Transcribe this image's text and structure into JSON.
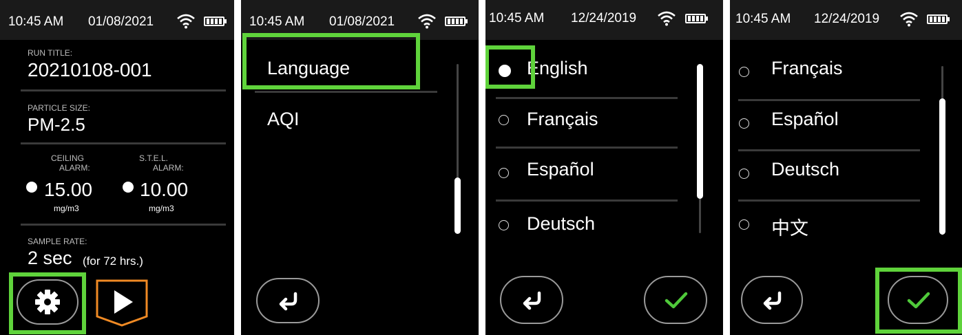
{
  "screen1": {
    "time": "10:45 AM",
    "date": "01/08/2021",
    "run_title_label": "RUN TITLE:",
    "run_title_value": "20210108-001",
    "particle_label": "PARTICLE SIZE:",
    "particle_value": "PM-2.5",
    "ceiling_label_1": "CEILING",
    "ceiling_label_2": "ALARM:",
    "ceiling_value": "15.00",
    "ceiling_unit": "mg/m3",
    "stel_label_1": "S.T.E.L.",
    "stel_label_2": "ALARM:",
    "stel_value": "10.00",
    "stel_unit": "mg/m3",
    "sample_label": "SAMPLE RATE:",
    "sample_value": "2 sec",
    "sample_note": "(for 72 hrs.)",
    "settings_icon": "gear-icon",
    "play_icon": "play-icon"
  },
  "screen2": {
    "time": "10:45 AM",
    "date": "01/08/2021",
    "items": [
      "Language",
      "AQI"
    ],
    "back_icon": "return-arrow-icon"
  },
  "screen3": {
    "time": "10:45 AM",
    "date": "12/24/2019",
    "languages": [
      "English",
      "Français",
      "Español",
      "Deutsch"
    ],
    "selected": "English"
  },
  "screen4": {
    "time": "10:45 AM",
    "date": "12/24/2019",
    "languages": [
      "Français",
      "Español",
      "Deutsch",
      "中文"
    ]
  },
  "colors": {
    "highlight": "#5fd33b",
    "confirm": "#4fc93a",
    "play_border": "#f08a24",
    "background": "#000000"
  }
}
